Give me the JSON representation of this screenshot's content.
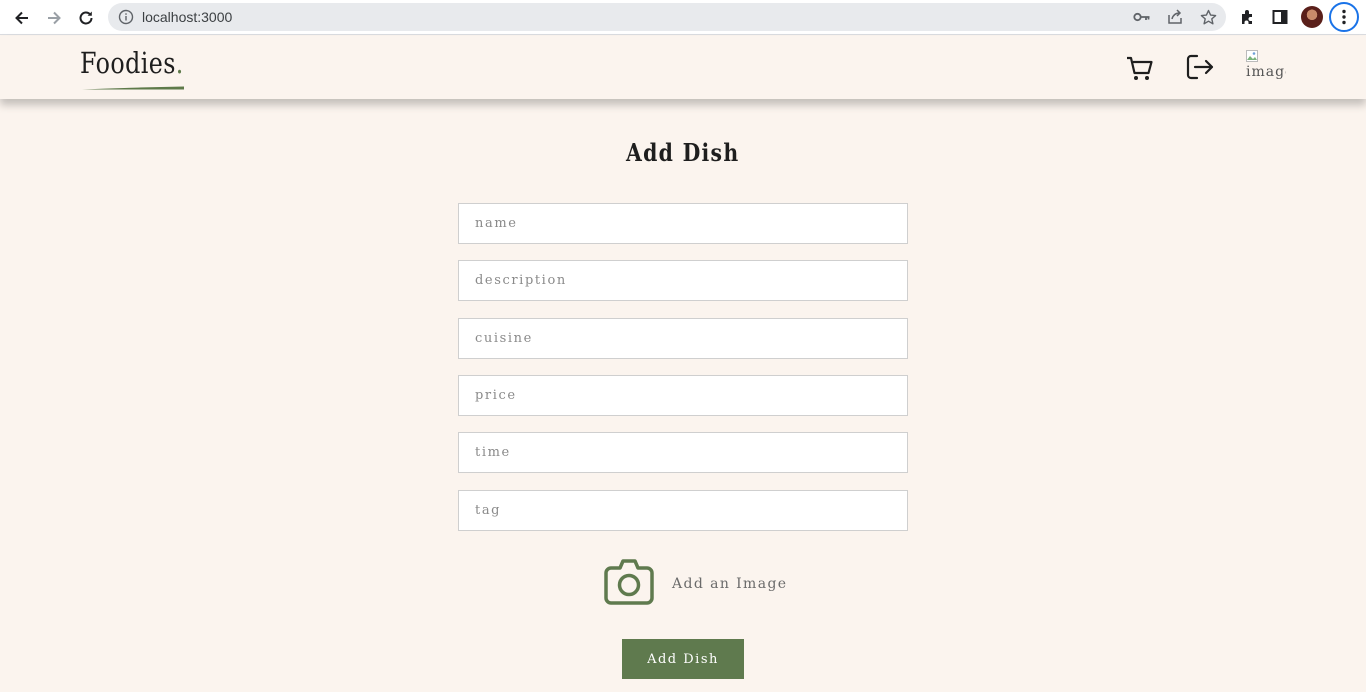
{
  "browser": {
    "url": "localhost:3000"
  },
  "header": {
    "logo_text": "Foodies",
    "logo_dot": ".",
    "profile_image_alt": "image"
  },
  "form": {
    "title": "Add Dish",
    "fields": [
      {
        "name": "name",
        "placeholder": "name",
        "value": ""
      },
      {
        "name": "description",
        "placeholder": "description",
        "value": ""
      },
      {
        "name": "cuisine",
        "placeholder": "cuisine",
        "value": ""
      },
      {
        "name": "price",
        "placeholder": "price",
        "value": ""
      },
      {
        "name": "time",
        "placeholder": "time",
        "value": ""
      },
      {
        "name": "tag",
        "placeholder": "tag",
        "value": ""
      }
    ],
    "add_image_label": "Add an Image",
    "submit_label": "Add Dish"
  },
  "colors": {
    "background": "#fbf4ee",
    "accent": "#5f7a4e",
    "chrome_focus": "#1a73e8"
  }
}
